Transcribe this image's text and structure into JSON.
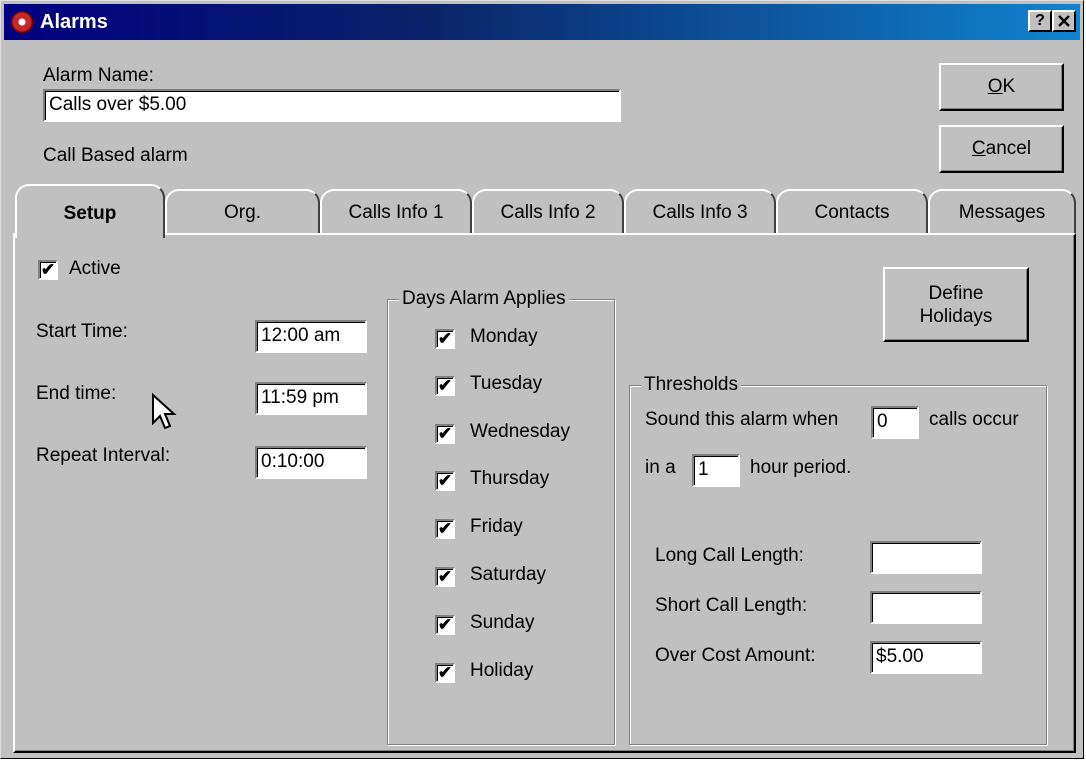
{
  "window": {
    "title": "Alarms",
    "help_label": "?",
    "close_label": "✕"
  },
  "header": {
    "alarm_name_label": "Alarm Name:",
    "alarm_name_value": "Calls over $5.00",
    "alarm_type_text": "Call Based alarm",
    "ok_button": {
      "accel": "O",
      "rest": "K"
    },
    "cancel_button": {
      "accel": "C",
      "rest": "ancel"
    }
  },
  "tabs": [
    {
      "label": "Setup",
      "active": true
    },
    {
      "label": "Org."
    },
    {
      "label": "Calls Info 1"
    },
    {
      "label": "Calls Info 2"
    },
    {
      "label": "Calls Info 3"
    },
    {
      "label": "Contacts"
    },
    {
      "label": "Messages"
    }
  ],
  "setup": {
    "active_label": "Active",
    "active_checked": true,
    "start_time_label": "Start Time:",
    "start_time_value": "12:00 am",
    "end_time_label": "End time:",
    "end_time_value": "11:59 pm",
    "repeat_interval_label": "Repeat Interval:",
    "repeat_interval_value": "0:10:00",
    "days_group_title": "Days Alarm Applies",
    "days": [
      {
        "label": "Monday",
        "checked": true
      },
      {
        "label": "Tuesday",
        "checked": true
      },
      {
        "label": "Wednesday",
        "checked": true
      },
      {
        "label": "Thursday",
        "checked": true
      },
      {
        "label": "Friday",
        "checked": true
      },
      {
        "label": "Saturday",
        "checked": true
      },
      {
        "label": "Sunday",
        "checked": true
      },
      {
        "label": "Holiday",
        "checked": true
      }
    ],
    "define_holidays_line1": "Define",
    "define_holidays_line2": "Holidays",
    "thresholds": {
      "title": "Thresholds",
      "sound_prefix": "Sound this alarm when",
      "calls_count_value": "0",
      "calls_suffix": "calls occur",
      "in_a_label": "in a",
      "hour_value": "1",
      "hour_suffix": "hour period.",
      "long_call_label": "Long Call Length:",
      "long_call_value": "",
      "short_call_label": "Short Call Length:",
      "short_call_value": "",
      "over_cost_label": "Over Cost Amount:",
      "over_cost_value": "$5.00"
    }
  },
  "check_mark": "✔",
  "colors": {
    "titlebar_start": "#000080",
    "titlebar_end": "#1084d0",
    "window_face": "#c0c0c0"
  }
}
